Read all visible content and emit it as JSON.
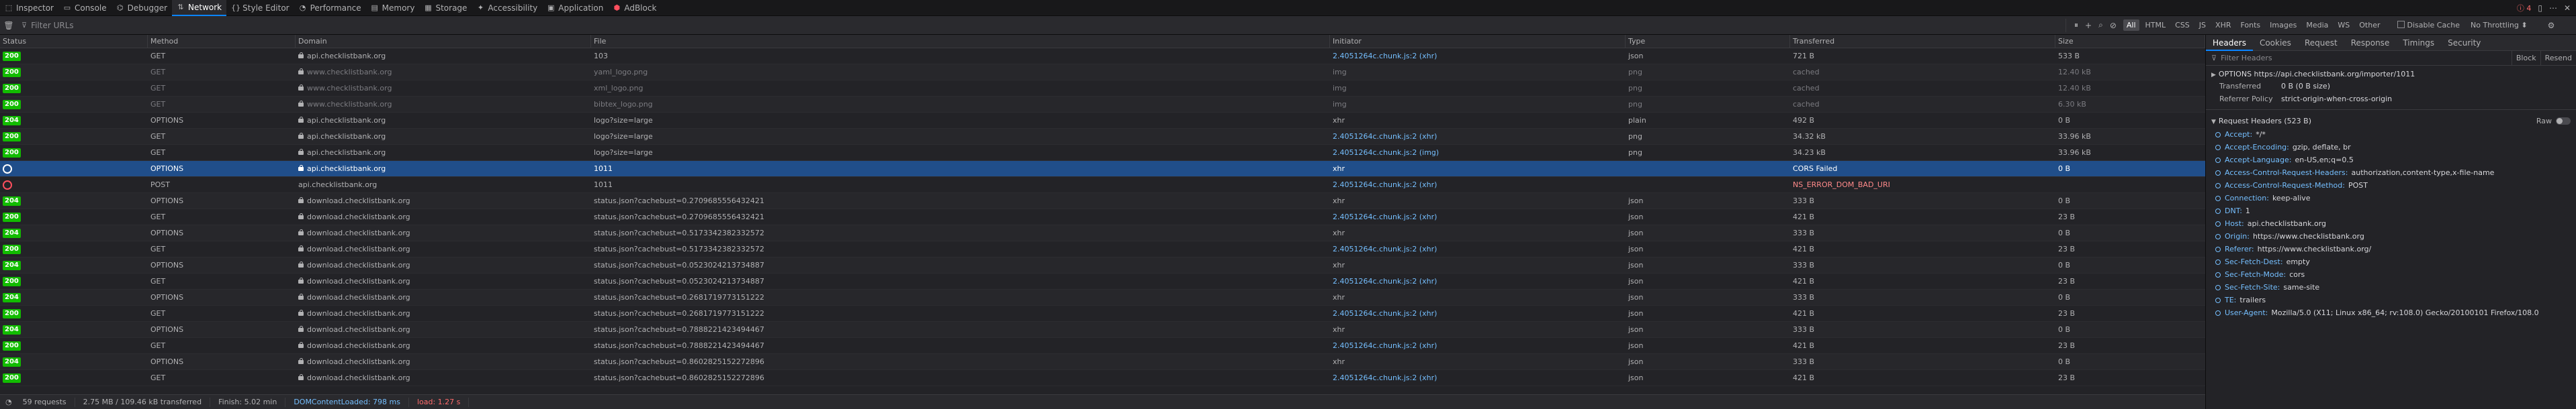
{
  "toolbar": {
    "tabs": [
      {
        "label": "Inspector",
        "icon": "inspector-icon"
      },
      {
        "label": "Console",
        "icon": "console-icon"
      },
      {
        "label": "Debugger",
        "icon": "debugger-icon"
      },
      {
        "label": "Network",
        "icon": "network-icon",
        "active": true
      },
      {
        "label": "Style Editor",
        "icon": "style-editor-icon"
      },
      {
        "label": "Performance",
        "icon": "performance-icon"
      },
      {
        "label": "Memory",
        "icon": "memory-icon"
      },
      {
        "label": "Storage",
        "icon": "storage-icon"
      },
      {
        "label": "Accessibility",
        "icon": "accessibility-icon"
      },
      {
        "label": "Application",
        "icon": "application-icon"
      },
      {
        "label": "AdBlock",
        "icon": "adblock-icon"
      }
    ],
    "error_count": "4"
  },
  "filterbar": {
    "placeholder": "Filter URLs",
    "types": [
      "All",
      "HTML",
      "CSS",
      "JS",
      "XHR",
      "Fonts",
      "Images",
      "Media",
      "WS",
      "Other"
    ],
    "active_type": "All",
    "disable_cache_label": "Disable Cache",
    "throttling_label": "No Throttling ⬍"
  },
  "table": {
    "headers": [
      "Status",
      "Method",
      "Domain",
      "File",
      "Initiator",
      "Type",
      "Transferred",
      "Size"
    ],
    "rows": [
      {
        "status": "200",
        "method": "GET",
        "domain": "api.checklistbank.org",
        "file": "103",
        "initiator": "2.4051264c.chunk.js:2 (xhr)",
        "type": "json",
        "transferred": "721 B",
        "size": "533 B",
        "lock": true
      },
      {
        "status": "200",
        "method": "GET",
        "domain": "www.checklistbank.org",
        "file": "yaml_logo.png",
        "initiator": "img",
        "type": "png",
        "transferred": "cached",
        "size": "12.40 kB",
        "lock": true,
        "dim": true
      },
      {
        "status": "200",
        "method": "GET",
        "domain": "www.checklistbank.org",
        "file": "xml_logo.png",
        "initiator": "img",
        "type": "png",
        "transferred": "cached",
        "size": "12.40 kB",
        "lock": true,
        "dim": true
      },
      {
        "status": "200",
        "method": "GET",
        "domain": "www.checklistbank.org",
        "file": "bibtex_logo.png",
        "initiator": "img",
        "type": "png",
        "transferred": "cached",
        "size": "6.30 kB",
        "lock": true,
        "dim": true
      },
      {
        "status": "204",
        "method": "OPTIONS",
        "domain": "api.checklistbank.org",
        "file": "logo?size=large",
        "initiator": "xhr",
        "type": "plain",
        "transferred": "492 B",
        "size": "0 B",
        "lock": true
      },
      {
        "status": "200",
        "method": "GET",
        "domain": "api.checklistbank.org",
        "file": "logo?size=large",
        "initiator": "2.4051264c.chunk.js:2 (xhr)",
        "type": "png",
        "transferred": "34.32 kB",
        "size": "33.96 kB",
        "lock": true
      },
      {
        "status": "200",
        "method": "GET",
        "domain": "api.checklistbank.org",
        "file": "logo?size=large",
        "initiator": "2.4051264c.chunk.js:2 (img)",
        "type": "png",
        "transferred": "34.23 kB",
        "size": "33.96 kB",
        "lock": true
      },
      {
        "status": "blocked",
        "method": "OPTIONS",
        "domain": "api.checklistbank.org",
        "file": "1011",
        "initiator": "xhr",
        "type": "",
        "transferred": "CORS Failed",
        "size": "0 B",
        "lock": true,
        "selected": true
      },
      {
        "status": "error",
        "method": "POST",
        "domain": "api.checklistbank.org",
        "file": "1011",
        "initiator": "2.4051264c.chunk.js:2 (xhr)",
        "type": "",
        "transferred": "NS_ERROR_DOM_BAD_URI",
        "size": "",
        "lock": false,
        "error": true
      },
      {
        "status": "204",
        "method": "OPTIONS",
        "domain": "download.checklistbank.org",
        "file": "status.json?cachebust=0.2709685556432421",
        "initiator": "xhr",
        "type": "json",
        "transferred": "333 B",
        "size": "0 B",
        "lock": true
      },
      {
        "status": "200",
        "method": "GET",
        "domain": "download.checklistbank.org",
        "file": "status.json?cachebust=0.2709685556432421",
        "initiator": "2.4051264c.chunk.js:2 (xhr)",
        "type": "json",
        "transferred": "421 B",
        "size": "23 B",
        "lock": true
      },
      {
        "status": "204",
        "method": "OPTIONS",
        "domain": "download.checklistbank.org",
        "file": "status.json?cachebust=0.5173342382332572",
        "initiator": "xhr",
        "type": "json",
        "transferred": "333 B",
        "size": "0 B",
        "lock": true
      },
      {
        "status": "200",
        "method": "GET",
        "domain": "download.checklistbank.org",
        "file": "status.json?cachebust=0.5173342382332572",
        "initiator": "2.4051264c.chunk.js:2 (xhr)",
        "type": "json",
        "transferred": "421 B",
        "size": "23 B",
        "lock": true
      },
      {
        "status": "204",
        "method": "OPTIONS",
        "domain": "download.checklistbank.org",
        "file": "status.json?cachebust=0.0523024213734887",
        "initiator": "xhr",
        "type": "json",
        "transferred": "333 B",
        "size": "0 B",
        "lock": true
      },
      {
        "status": "200",
        "method": "GET",
        "domain": "download.checklistbank.org",
        "file": "status.json?cachebust=0.0523024213734887",
        "initiator": "2.4051264c.chunk.js:2 (xhr)",
        "type": "json",
        "transferred": "421 B",
        "size": "23 B",
        "lock": true
      },
      {
        "status": "204",
        "method": "OPTIONS",
        "domain": "download.checklistbank.org",
        "file": "status.json?cachebust=0.2681719773151222",
        "initiator": "xhr",
        "type": "json",
        "transferred": "333 B",
        "size": "0 B",
        "lock": true
      },
      {
        "status": "200",
        "method": "GET",
        "domain": "download.checklistbank.org",
        "file": "status.json?cachebust=0.2681719773151222",
        "initiator": "2.4051264c.chunk.js:2 (xhr)",
        "type": "json",
        "transferred": "421 B",
        "size": "23 B",
        "lock": true
      },
      {
        "status": "204",
        "method": "OPTIONS",
        "domain": "download.checklistbank.org",
        "file": "status.json?cachebust=0.7888221423494467",
        "initiator": "xhr",
        "type": "json",
        "transferred": "333 B",
        "size": "0 B",
        "lock": true
      },
      {
        "status": "200",
        "method": "GET",
        "domain": "download.checklistbank.org",
        "file": "status.json?cachebust=0.7888221423494467",
        "initiator": "2.4051264c.chunk.js:2 (xhr)",
        "type": "json",
        "transferred": "421 B",
        "size": "23 B",
        "lock": true
      },
      {
        "status": "204",
        "method": "OPTIONS",
        "domain": "download.checklistbank.org",
        "file": "status.json?cachebust=0.8602825152272896",
        "initiator": "xhr",
        "type": "json",
        "transferred": "333 B",
        "size": "0 B",
        "lock": true
      },
      {
        "status": "200",
        "method": "GET",
        "domain": "download.checklistbank.org",
        "file": "status.json?cachebust=0.8602825152272896",
        "initiator": "2.4051264c.chunk.js:2 (xhr)",
        "type": "json",
        "transferred": "421 B",
        "size": "23 B",
        "lock": true
      }
    ]
  },
  "statusbar": {
    "requests": "59 requests",
    "transferred": "2.75 MB / 109.46 kB transferred",
    "finish": "Finish: 5.02 min",
    "dcl": "DOMContentLoaded: 798 ms",
    "load": "load: 1.27 s"
  },
  "details": {
    "tabs": [
      "Headers",
      "Cookies",
      "Request",
      "Response",
      "Timings",
      "Security"
    ],
    "active_tab": "Headers",
    "filter_placeholder": "Filter Headers",
    "block_label": "Block",
    "resend_label": "Resend",
    "request_line": "OPTIONS https://api.checklistbank.org/importer/1011",
    "transferred_label": "Transferred",
    "transferred_value": "0 B (0 B size)",
    "referrer_label": "Referrer Policy",
    "referrer_value": "strict-origin-when-cross-origin",
    "request_headers_title": "Request Headers (523 B)",
    "raw_label": "Raw",
    "request_headers": [
      {
        "name": "Accept:",
        "value": "*/*"
      },
      {
        "name": "Accept-Encoding:",
        "value": "gzip, deflate, br"
      },
      {
        "name": "Accept-Language:",
        "value": "en-US,en;q=0.5"
      },
      {
        "name": "Access-Control-Request-Headers:",
        "value": "authorization,content-type,x-file-name"
      },
      {
        "name": "Access-Control-Request-Method:",
        "value": "POST"
      },
      {
        "name": "Connection:",
        "value": "keep-alive"
      },
      {
        "name": "DNT:",
        "value": "1"
      },
      {
        "name": "Host:",
        "value": "api.checklistbank.org"
      },
      {
        "name": "Origin:",
        "value": "https://www.checklistbank.org"
      },
      {
        "name": "Referer:",
        "value": "https://www.checklistbank.org/"
      },
      {
        "name": "Sec-Fetch-Dest:",
        "value": "empty"
      },
      {
        "name": "Sec-Fetch-Mode:",
        "value": "cors"
      },
      {
        "name": "Sec-Fetch-Site:",
        "value": "same-site"
      },
      {
        "name": "TE:",
        "value": "trailers"
      },
      {
        "name": "User-Agent:",
        "value": "Mozilla/5.0 (X11; Linux x86_64; rv:108.0) Gecko/20100101 Firefox/108.0"
      }
    ]
  }
}
